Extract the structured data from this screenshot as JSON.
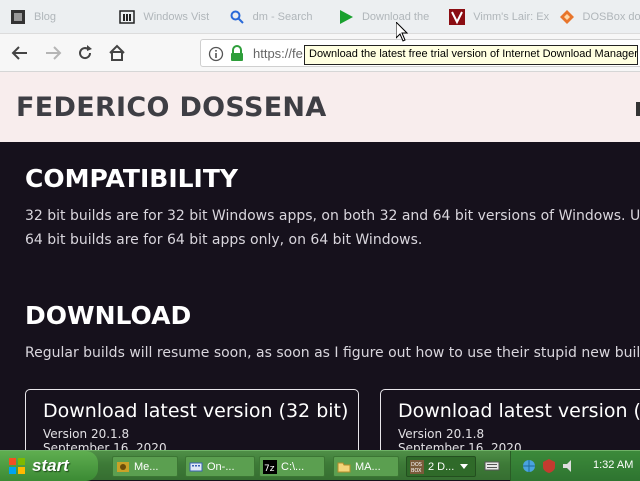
{
  "bookmarks": [
    {
      "label": "Blog",
      "icon": "dark-square-icon"
    },
    {
      "label": "Windows Vist",
      "icon": "building-icon"
    },
    {
      "label": "dm - Search",
      "icon": "search-icon"
    },
    {
      "label": "Download the",
      "icon": "play-icon"
    },
    {
      "label": "Vimm's Lair: Ex",
      "icon": "vimm-icon"
    },
    {
      "label": "DOSBox dow",
      "icon": "dosbox-icon"
    }
  ],
  "url": {
    "text": "https://fe"
  },
  "tooltip": {
    "text": "Download the latest free trial version of Internet Download Manager"
  },
  "site": {
    "title": "FEDERICO DOSSENA"
  },
  "compatibility": {
    "heading": "COMPATIBILITY",
    "line1": "32 bit builds are for 32 bit Windows apps, on both 32 and 64 bit versions of Windows. U",
    "line2": "64 bit builds are for 64 bit apps only, on 64 bit Windows."
  },
  "download": {
    "heading": "DOWNLOAD",
    "text": "Regular builds will resume soon, as soon as I figure out how to use their stupid new buil",
    "cards": [
      {
        "title": "Download latest version (32 bit)",
        "version": "Version 20.1.8",
        "date": "September 16, 2020"
      },
      {
        "title": "Download latest version (6",
        "version": "Version 20.1.8",
        "date": "September 16, 2020"
      }
    ]
  },
  "taskbar": {
    "start": "start",
    "tasks": [
      {
        "label": "Me..."
      },
      {
        "label": "On-..."
      },
      {
        "label": "C:\\..."
      },
      {
        "label": "MA..."
      },
      {
        "label": "2 D..."
      }
    ],
    "clock": "1:32 AM"
  },
  "colors": {
    "page_background": "#16111c",
    "header_background": "#f8eded",
    "taskbar": "#3d7a37",
    "tooltip": "#ffffe1",
    "secure_lock": "#2e9e3a"
  }
}
